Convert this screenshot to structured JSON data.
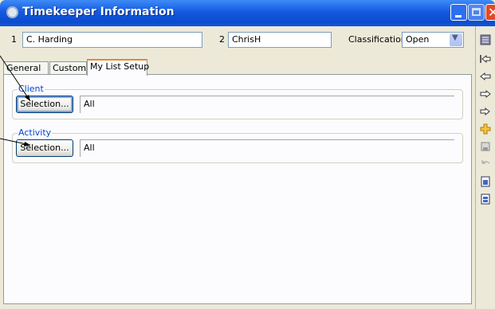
{
  "window": {
    "title": "Timekeeper Information"
  },
  "fields": {
    "field1_label": "1",
    "field1_value": "C. Harding",
    "field2_label": "2",
    "field2_value": "ChrisH",
    "classification_label": "Classification",
    "classification_value": "Open"
  },
  "tabs": [
    {
      "label": "General",
      "active": false
    },
    {
      "label": "Custom",
      "active": false
    },
    {
      "label": "My List Setup",
      "active": true
    }
  ],
  "groups": {
    "client": {
      "label": "Client",
      "button_label": "Selection...",
      "value": "All"
    },
    "activity": {
      "label": "Activity",
      "button_label": "Selection...",
      "value": "All"
    }
  },
  "toolbar_icons": [
    "list-icon",
    "first-record-icon",
    "previous-record-icon",
    "next-record-icon",
    "last-record-icon",
    "add-icon",
    "save-icon",
    "undo-icon",
    "report-icon",
    "report-document-icon"
  ],
  "colors": {
    "title_bar": "#1459e0",
    "group_label": "#0046d5",
    "active_tab_accent": "#e68b2c",
    "panel_bg": "#ece9d8"
  }
}
